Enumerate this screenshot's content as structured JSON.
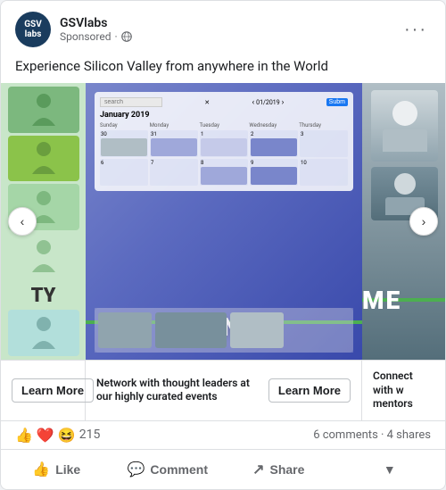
{
  "card": {
    "page_name": "GSVlabs",
    "sponsored_label": "Sponsored",
    "post_text": "Experience Silicon Valley from anywhere in the World",
    "more_options_label": "···"
  },
  "carousel": {
    "items": [
      {
        "id": "people",
        "footer_learn_label": "Learn More"
      },
      {
        "id": "events",
        "title": "EVENTS",
        "calendar_month": "January 2019",
        "footer_desc": "Network with thought leaders at our highly curated events",
        "footer_learn_label": "Learn More"
      },
      {
        "id": "mentors",
        "title": "ME",
        "footer_desc": "Connect with w mentors"
      }
    ],
    "arrow_left_label": "‹",
    "arrow_right_label": "›",
    "calendar": {
      "search_placeholder": "search",
      "date_nav": "01/2019",
      "days": [
        "Sunday",
        "Monday",
        "Tuesday",
        "Wednesday",
        "Thursday"
      ]
    }
  },
  "reactions": {
    "emojis": [
      "👍",
      "❤️",
      "😆"
    ],
    "count": "215",
    "comments_label": "6 comments",
    "shares_label": "4 shares"
  },
  "actions": {
    "like_label": "Like",
    "comment_label": "Comment",
    "share_label": "Share",
    "more_label": "▼"
  }
}
